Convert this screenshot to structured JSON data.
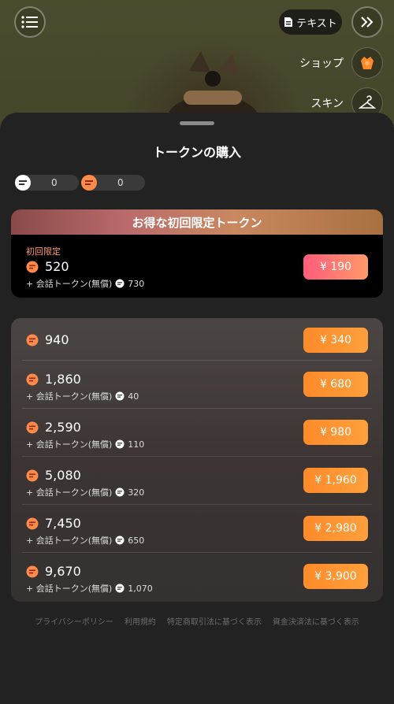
{
  "top": {
    "text_button_label": "テキスト",
    "side_items": [
      {
        "label": "ショップ",
        "icon": "shop-icon"
      },
      {
        "label": "スキン",
        "icon": "hanger-icon"
      }
    ]
  },
  "sheet": {
    "title": "トークンの購入",
    "balances": [
      {
        "icon": "chat-token-icon",
        "value": "0"
      },
      {
        "icon": "token-icon",
        "value": "0"
      }
    ],
    "offer": {
      "header": "お得な初回限定トークン",
      "tag": "初回限定",
      "amount": "520",
      "bonus_label": "+ 会話トークン(無償)",
      "bonus_value": "730",
      "price": "¥ 190"
    },
    "packages": [
      {
        "amount": "940",
        "bonus_label": "",
        "bonus_value": "",
        "price": "¥ 340"
      },
      {
        "amount": "1,860",
        "bonus_label": "+ 会話トークン(無償)",
        "bonus_value": "40",
        "price": "¥ 680"
      },
      {
        "amount": "2,590",
        "bonus_label": "+ 会話トークン(無償)",
        "bonus_value": "110",
        "price": "¥ 980"
      },
      {
        "amount": "5,080",
        "bonus_label": "+ 会話トークン(無償)",
        "bonus_value": "320",
        "price": "¥ 1,960"
      },
      {
        "amount": "7,450",
        "bonus_label": "+ 会話トークン(無償)",
        "bonus_value": "650",
        "price": "¥ 2,980"
      },
      {
        "amount": "9,670",
        "bonus_label": "+ 会話トークン(無償)",
        "bonus_value": "1,070",
        "price": "¥ 3,900"
      }
    ],
    "footer_links": [
      "プライバシーポリシー",
      "利用規約",
      "特定商取引法に基づく表示",
      "資金決済法に基づく表示"
    ]
  },
  "colors": {
    "accent_orange": "#ff9a3c",
    "offer_pink": "#ff5c7a",
    "sheet_bg": "#222223"
  }
}
